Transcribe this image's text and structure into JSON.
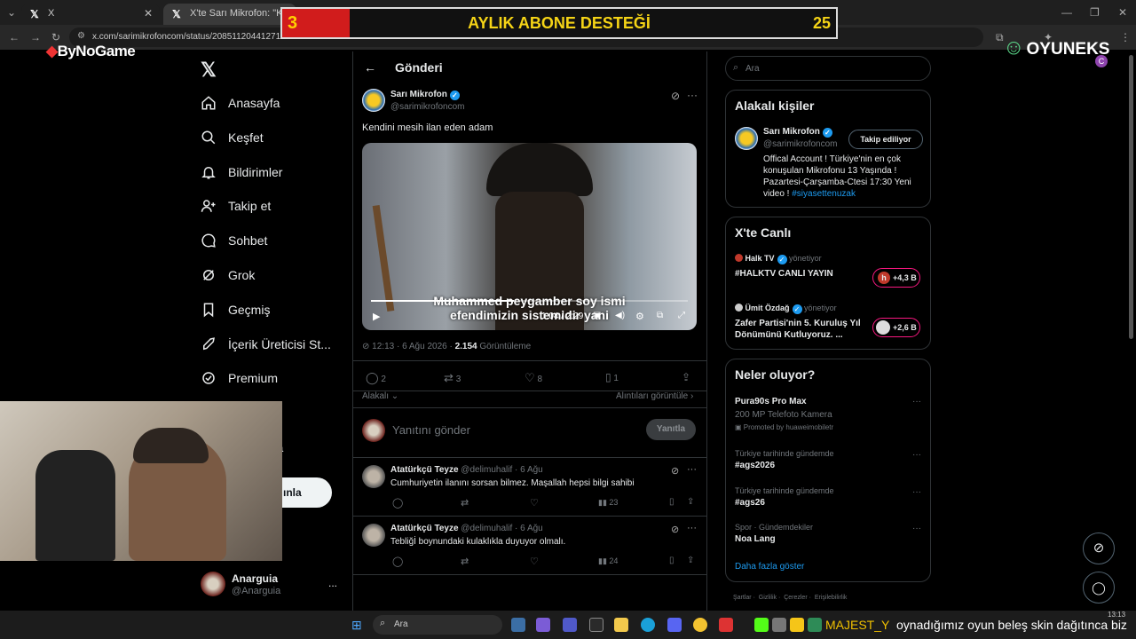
{
  "browser": {
    "tabs": [
      {
        "label": "X",
        "active": false
      },
      {
        "label": "X'te Sarı Mikrofon: \"Kendini m",
        "active": true
      }
    ],
    "url": "x.com/sarimikrofoncom/status/20851120441271996"
  },
  "overlay": {
    "left_number": "3",
    "title": "AYLIK ABONE DESTEĞİ",
    "right_number": "25",
    "left_logo": "ByNoGame",
    "right_logo": "OYUNEKS"
  },
  "nav": {
    "logo": "X",
    "items": [
      {
        "label": "Anasayfa",
        "icon": "home-icon"
      },
      {
        "label": "Keşfet",
        "icon": "search-icon"
      },
      {
        "label": "Bildirimler",
        "icon": "bell-icon"
      },
      {
        "label": "Takip et",
        "icon": "follow-icon"
      },
      {
        "label": "Sohbet",
        "icon": "chat-icon"
      },
      {
        "label": "Grok",
        "icon": "grok-icon"
      },
      {
        "label": "Geçmiş",
        "icon": "bookmark-icon"
      },
      {
        "label": "İçerik Üreticisi St...",
        "icon": "rocket-icon"
      },
      {
        "label": "Premium",
        "icon": "premium-icon"
      }
    ],
    "partial_text_a": "a",
    "partial_post_button": "ınla",
    "account": {
      "name": "Anarguia",
      "handle": "@Anarguia",
      "more": "..."
    }
  },
  "post": {
    "header_title": "Gönderi",
    "author_name": "Sarı Mikrofon",
    "author_handle": "@sarimikrofoncom",
    "text": "Kendini mesih ilan eden adam",
    "video": {
      "subtitle_line1": "Muhammed peygamber soy ismi",
      "subtitle_line2": "efendimizin sistemidir yani",
      "time": "1:04 / 2:29",
      "progress": 0.45
    },
    "time": "12:13 · 6 Ağu 2026 ·",
    "views": "2.154",
    "views_label": "Görüntüleme",
    "stats": {
      "replies": "2",
      "reposts": "3",
      "likes": "8",
      "bookmarks": "1"
    },
    "filter_label": "Alakalı",
    "quotes_link": "Alıntıları görüntüle",
    "reply_placeholder": "Yanıtını gönder",
    "reply_button": "Yanıtla"
  },
  "replies": [
    {
      "name": "Atatürkçü Teyze",
      "handle": "@delimuhalif",
      "date": "· 6 Ağu",
      "text": "Cumhuriyetin ilanını sorsan bilmez. Maşallah hepsi bilgi sahibi",
      "views": "23"
    },
    {
      "name": "Atatürkçü Teyze",
      "handle": "@delimuhalif",
      "date": "· 6 Ağu",
      "text": "Tebliğİ boynundaki kulaklıkla duyuyor olmalı.",
      "views": "24"
    }
  ],
  "sidebar": {
    "search_placeholder": "Ara",
    "relevant": {
      "title": "Alakalı kişiler",
      "name": "Sarı Mikrofon",
      "handle": "@sarimikrofoncom",
      "follow_button": "Takip ediliyor",
      "bio": "Offical Account ! Türkiye'nin en çok konuşulan Mikrofonu 13 Yaşında ! Pazartesi-Çarşamba-Ctesi 17:30 Yeni video !",
      "hashtag": "#siyasettenuzak"
    },
    "live": {
      "title": "X'te Canlı",
      "items": [
        {
          "host": "Halk TV",
          "role": "yönetiyor",
          "title": "#HALKTV CANLI YAYIN",
          "count": "+4,3 B"
        },
        {
          "host": "Ümit Özdağ",
          "role": "yönetiyor",
          "title": "Zafer Partisi'nin 5. Kuruluş Yıl Dönümünü Kutluyoruz. ...",
          "count": "+2,6 B"
        }
      ]
    },
    "trends": {
      "title": "Neler oluyor?",
      "items": [
        {
          "context": "",
          "title": "Pura90s Pro Max",
          "sub": "200 MP Telefoto Kamera",
          "promo": "Promoted by huaweimobiletr"
        },
        {
          "context": "Türkiye tarihinde gündemde",
          "title": "#ags2026",
          "sub": "",
          "promo": ""
        },
        {
          "context": "Türkiye tarihinde gündemde",
          "title": "#ags26",
          "sub": "",
          "promo": ""
        },
        {
          "context": "Spor · Gündemdekiler",
          "title": "Noa Lang",
          "sub": "",
          "promo": ""
        }
      ],
      "more": "Daha fazla göster"
    },
    "footer": [
      "Şartlar",
      "Gizlilik",
      "Çerezler",
      "Erişilebilirlik"
    ]
  },
  "taskbar": {
    "search": "Ara",
    "username": "MAJEST_Y",
    "ticker": "oynadığımız oyun beleş skin dağıtınca biz",
    "clock": "13:13"
  }
}
